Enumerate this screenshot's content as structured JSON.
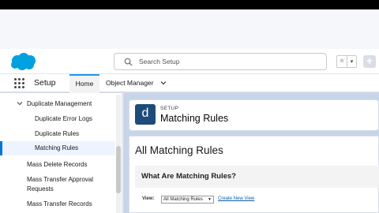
{
  "header": {
    "search_placeholder": "Search Setup",
    "favorite_icon": "star-icon",
    "favorite_dropdown_icon": "chevron-down-icon",
    "add_icon": "plus-icon"
  },
  "nav": {
    "app_name": "Setup",
    "tabs": [
      {
        "label": "Home",
        "active": true
      },
      {
        "label": "Object Manager",
        "active": false
      }
    ]
  },
  "sidebar": {
    "group": "Duplicate Management",
    "group_items": [
      {
        "label": "Duplicate Error Logs"
      },
      {
        "label": "Duplicate Rules"
      },
      {
        "label": "Matching Rules",
        "selected": true
      }
    ],
    "items": [
      {
        "label": "Mass Delete Records"
      },
      {
        "label": "Mass Transfer Approval"
      },
      {
        "label": "Requests"
      },
      {
        "label": "Mass Transfer Records"
      }
    ]
  },
  "page_header": {
    "icon_letter": "d",
    "eyebrow": "SETUP",
    "title": "Matching Rules"
  },
  "content": {
    "title": "All Matching Rules",
    "section_title": "What Are Matching Rules?",
    "view_label": "View:",
    "view_selected": "All Matching Rules",
    "create_view_link": "Create New View"
  },
  "colors": {
    "brand": "#00a1e0",
    "accent": "#1b96ff",
    "page_header_icon": "#1e4c7a",
    "link": "#0b5cab"
  }
}
